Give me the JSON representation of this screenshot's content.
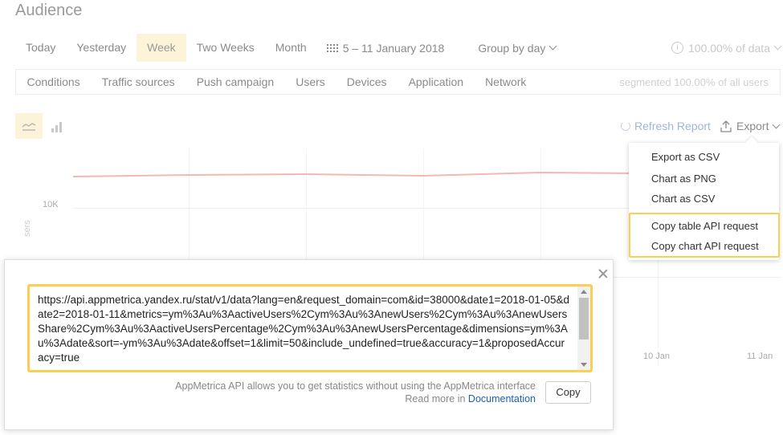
{
  "page": {
    "title": "Audience"
  },
  "periods": [
    "Today",
    "Yesterday",
    "Week",
    "Two Weeks",
    "Month"
  ],
  "active_period": "Week",
  "date_range": "5 – 11 January 2018",
  "group_by": "Group by day",
  "data_accuracy": "100.00% of data",
  "filters": [
    "Conditions",
    "Traffic sources",
    "Push campaign",
    "Users",
    "Devices",
    "Application",
    "Network"
  ],
  "segment_info": "segmented 100.00% of all users",
  "toolbar": {
    "refresh_label": "Refresh Report",
    "export_label": "Export"
  },
  "chart": {
    "y_tick": "10K",
    "y_label": "sers",
    "x_ticks": [
      "10 Jan",
      "11 Jan"
    ],
    "line_color": "#f2b8b4"
  },
  "export_menu": {
    "items": [
      "Export as CSV",
      "Chart as PNG",
      "Chart as CSV",
      "Copy table API request",
      "Copy chart API request"
    ]
  },
  "modal": {
    "api_url": "https://api.appmetrica.yandex.ru/stat/v1/data?lang=en&request_domain=com&id=38000&date1=2018-01-05&date2=2018-01-11&metrics=ym%3Au%3AactiveUsers%2Cym%3Au%3AnewUsers%2Cym%3Au%3AnewUsersShare%2Cym%3Au%3AactiveUsersPercentage%2Cym%3Au%3AnewUsersPercentage&dimensions=ym%3Au%3Adate&sort=-ym%3Au%3Adate&offset=1&limit=50&include_undefined=true&accuracy=1&proposedAccuracy=true",
    "note_line1": "AppMetrica API allows you to get statistics without using the AppMetrica interface",
    "note_line2_prefix": "Read more in ",
    "doc_link": "Documentation",
    "copy_label": "Copy"
  },
  "colors": {
    "accent_bg": "#fdf3d8",
    "highlight": "#fbcf54",
    "link": "#1b5fb3"
  }
}
